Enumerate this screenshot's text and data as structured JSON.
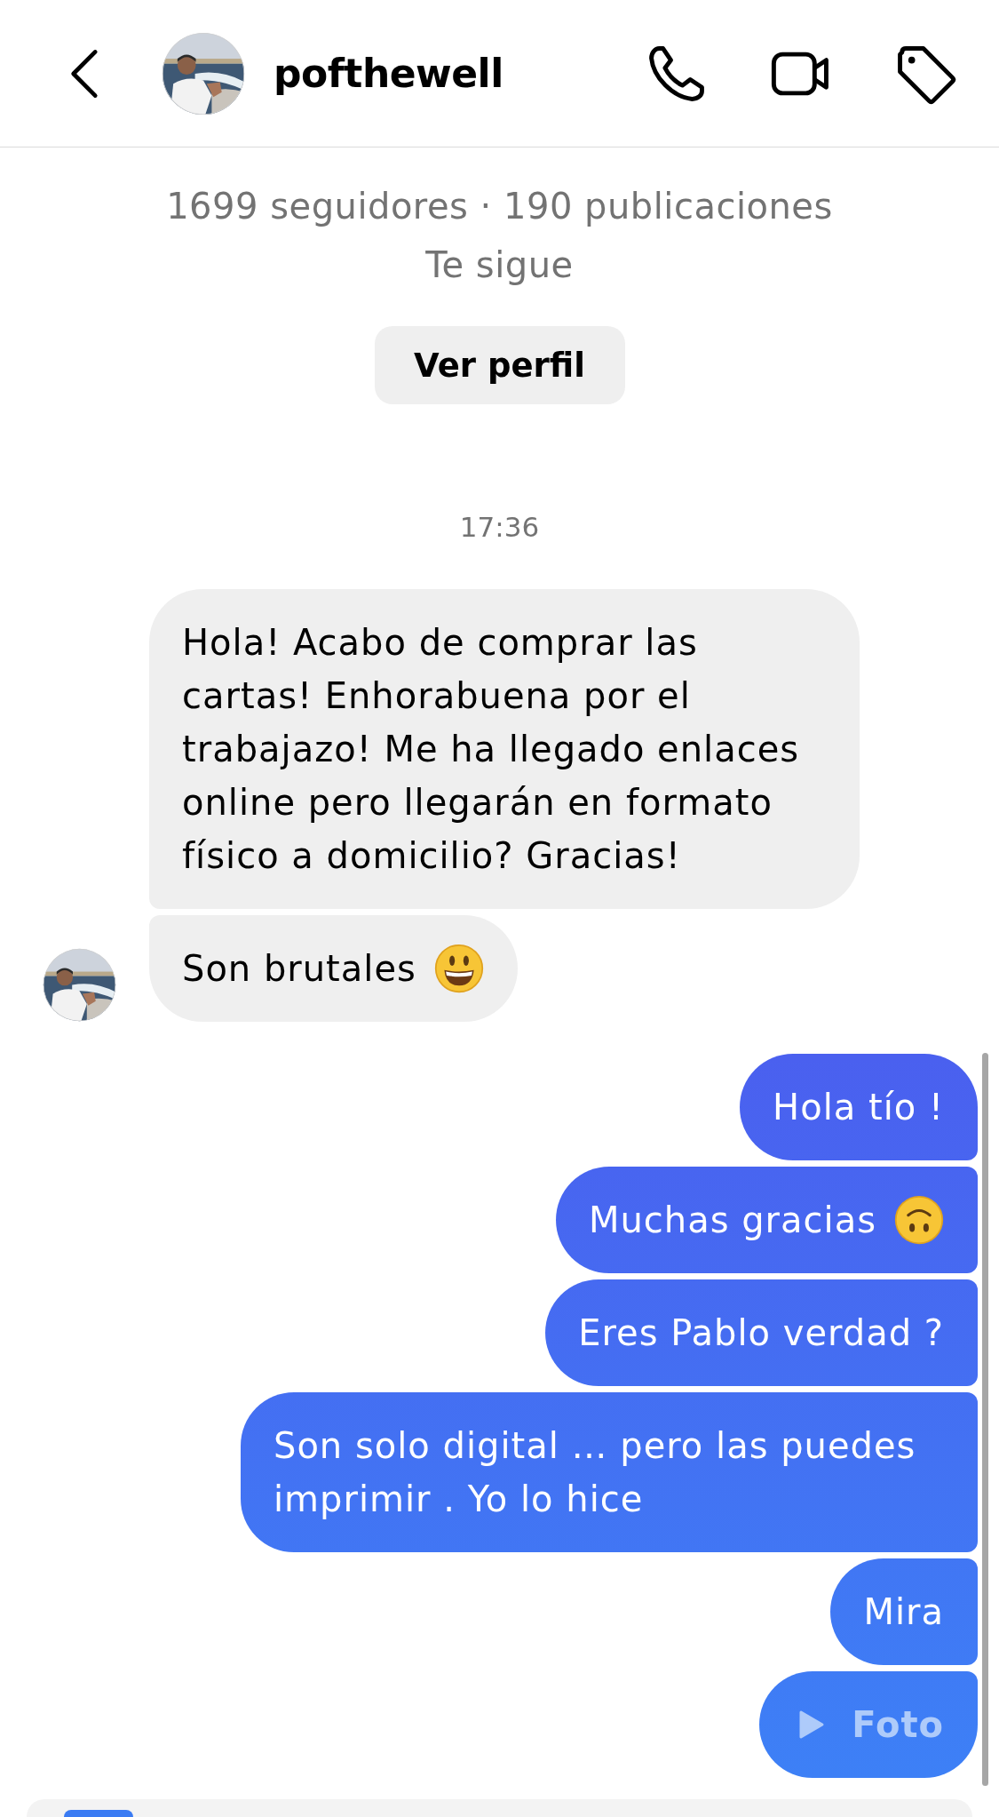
{
  "header": {
    "username": "pofthewell"
  },
  "profile": {
    "stats": "1699 seguidores · 190 publicaciones",
    "follow_status": "Te sigue",
    "button": "Ver perfil"
  },
  "timestamp": "17:36",
  "messages": [
    {
      "outgoing": false,
      "kind": "text",
      "text": "Hola! Acabo de comprar las cartas! Enhorabuena por el trabajazo! Me ha llegado enlaces online pero llegarán en formato físico a domicilio? Gracias!"
    },
    {
      "outgoing": false,
      "kind": "grinning",
      "text": "Son brutales"
    },
    {
      "outgoing": true,
      "kind": "text",
      "text": "Hola tío !"
    },
    {
      "outgoing": true,
      "kind": "upsidedown",
      "text": "Muchas gracias"
    },
    {
      "outgoing": true,
      "kind": "text",
      "text": "Eres Pablo verdad ?"
    },
    {
      "outgoing": true,
      "kind": "text",
      "text": "Son solo digital … pero las puedes imprimir . Yo lo hice"
    },
    {
      "outgoing": true,
      "kind": "text",
      "text": "Mira"
    },
    {
      "outgoing": true,
      "kind": "media",
      "text": "Foto"
    }
  ]
}
